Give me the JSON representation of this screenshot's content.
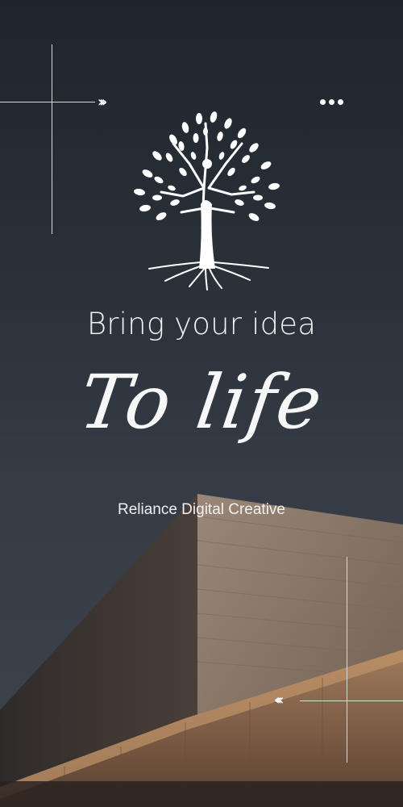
{
  "headline": "Bring your idea",
  "script_text": "To life",
  "brand": "Reliance Digital Creative",
  "icons": {
    "tree": "tree-of-life-icon",
    "chevrons_right": "chevrons-right-icon",
    "chevrons_left": "chevrons-left-icon",
    "more": "more-dots-icon"
  },
  "colors": {
    "sky_top": "#1f252d",
    "sky_bottom": "#3d444e",
    "text": "#f2f2f2",
    "building_lit": "#8a7565",
    "building_shadow": "#3a3330"
  }
}
